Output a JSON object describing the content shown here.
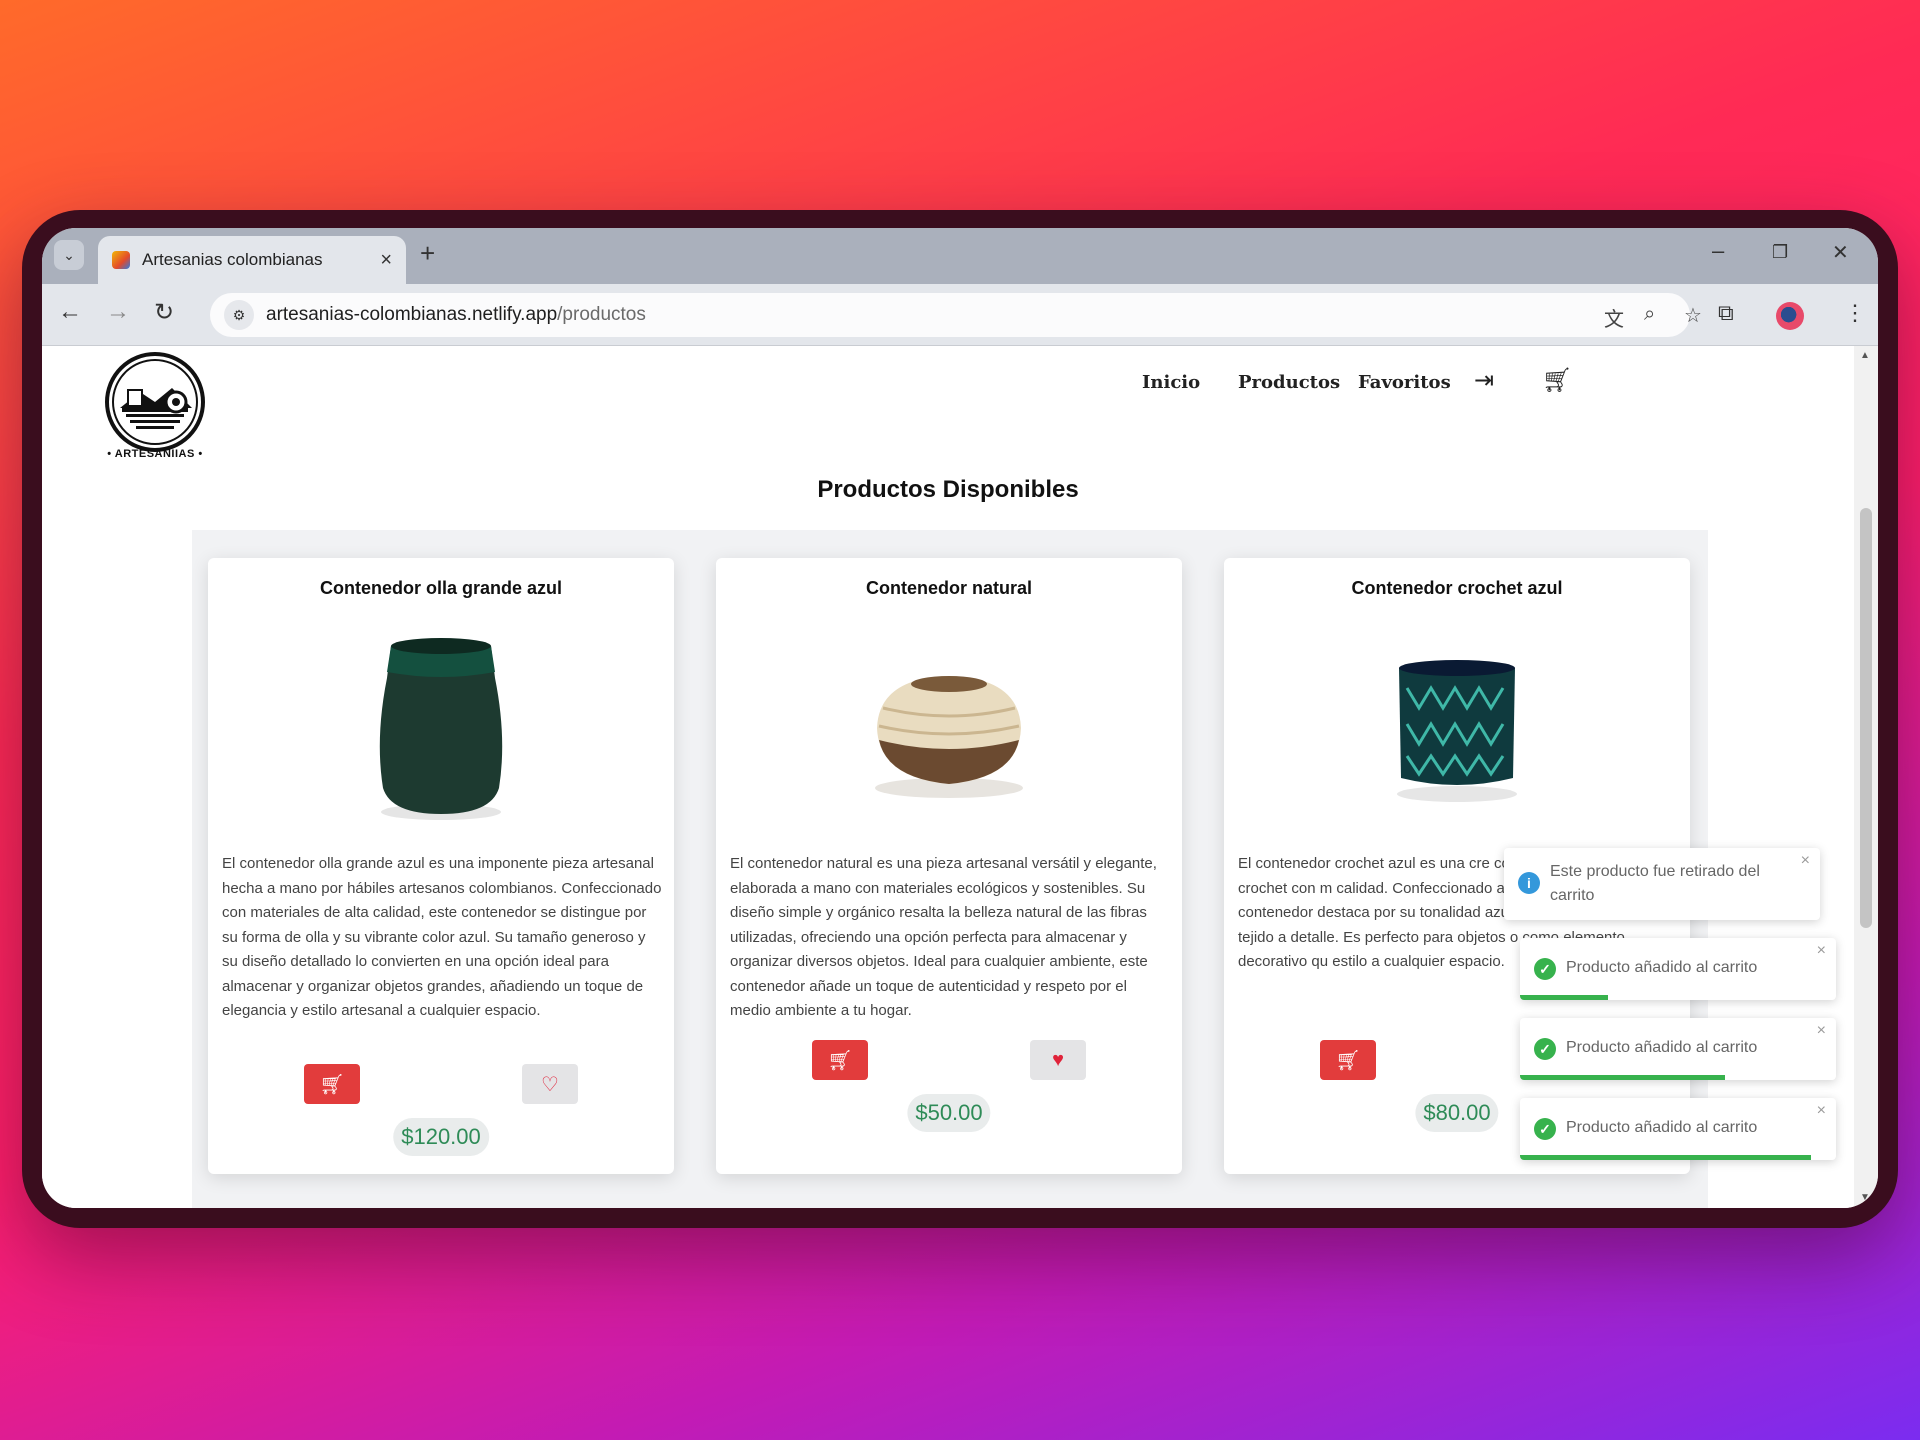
{
  "browser": {
    "tab_title": "Artesanias colombianas",
    "tab_close": "×",
    "new_tab": "+",
    "url_host": "artesanias-colombianas.netlify.app",
    "url_path": "/productos",
    "window_controls": [
      "–",
      "❐",
      "✕"
    ]
  },
  "site": {
    "logo_text": "• ARTESANIIAS •",
    "nav": [
      "Inicio",
      "Productos",
      "Favoritos"
    ],
    "page_title": "Productos Disponibles"
  },
  "products": [
    {
      "title": "Contenedor olla grande azul",
      "description": "El contenedor olla grande azul es una imponente pieza artesanal hecha a mano por hábiles artesanos colombianos. Confeccionado con materiales de alta calidad, este contenedor se distingue por su forma de olla y su vibrante color azul. Su tamaño generoso y su diseño detallado lo convierten en una opción ideal para almacenar y organizar objetos grandes, añadiendo un toque de elegancia y estilo artesanal a cualquier espacio.",
      "price": "$120.00",
      "favorite": false
    },
    {
      "title": "Contenedor natural",
      "description": "El contenedor natural es una pieza artesanal versátil y elegante, elaborada a mano con materiales ecológicos y sostenibles. Su diseño simple y orgánico resalta la belleza natural de las fibras utilizadas, ofreciendo una opción perfecta para almacenar y organizar diversos objetos. Ideal para cualquier ambiente, este contenedor añade un toque de autenticidad y respeto por el medio ambiente a tu hogar.",
      "price": "$50.00",
      "favorite": true
    },
    {
      "title": "Contenedor crochet azul",
      "description": "El contenedor crochet azul es una cre combina la técnica del crochet con m calidad. Confeccionado a mano por a este contenedor destaca por su tonalidad azul serena y su diseño tejido a detalle. Es perfecto para objetos o como elemento decorativo qu estilo a cualquier espacio.",
      "price": "$80.00",
      "favorite": false
    }
  ],
  "toasts": [
    {
      "type": "info",
      "text": "Este producto fue retirado del carrito",
      "progress": 0.0
    },
    {
      "type": "success",
      "text": "Producto añadido al carrito",
      "progress": 0.28
    },
    {
      "type": "success",
      "text": "Producto añadido al carrito",
      "progress": 0.65
    },
    {
      "type": "success",
      "text": "Producto añadido al carrito",
      "progress": 0.92
    }
  ],
  "colors": {
    "accent_red": "#e23c3c",
    "price_green": "#2e8b57",
    "toast_success": "#37b24d",
    "toast_info": "#3498db"
  }
}
